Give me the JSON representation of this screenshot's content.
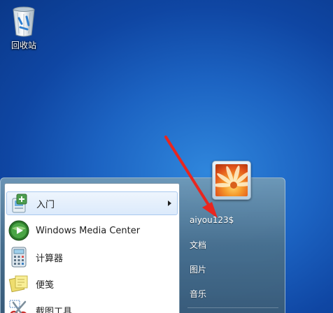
{
  "desktop": {
    "recycle_bin_label": "回收站",
    "recycle_bin_icon": "recycle-bin-icon"
  },
  "start_menu": {
    "programs": [
      {
        "label": "入门",
        "icon": "getting-started-icon",
        "has_submenu": true,
        "highlighted": true
      },
      {
        "label": "Windows Media Center",
        "icon": "media-center-icon",
        "has_submenu": false
      },
      {
        "label": "计算器",
        "icon": "calculator-icon",
        "has_submenu": false
      },
      {
        "label": "便笺",
        "icon": "sticky-notes-icon",
        "has_submenu": false
      },
      {
        "label": "截图工具",
        "icon": "snipping-tool-icon",
        "has_submenu": false
      }
    ],
    "user": {
      "name": "aiyou123$",
      "avatar_icon": "flower-avatar-icon"
    },
    "links": [
      {
        "label": "文档"
      },
      {
        "label": "图片"
      },
      {
        "label": "音乐"
      }
    ]
  },
  "colors": {
    "desktop_blue": "#1c63c2",
    "annotation_arrow": "#e8261f",
    "menu_frame": "#4a708c"
  }
}
